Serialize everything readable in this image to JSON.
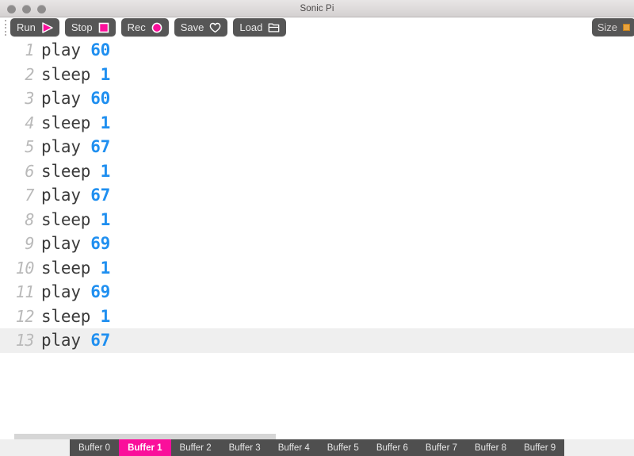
{
  "window": {
    "title": "Sonic Pi",
    "traffic_lights": [
      "close",
      "minimize",
      "maximize"
    ]
  },
  "toolbar": {
    "buttons": [
      {
        "label": "Run",
        "icon": "play-triangle-icon"
      },
      {
        "label": "Stop",
        "icon": "stop-square-icon"
      },
      {
        "label": "Rec",
        "icon": "record-circle-icon"
      },
      {
        "label": "Save",
        "icon": "heart-icon"
      },
      {
        "label": "Load",
        "icon": "folder-icon"
      }
    ],
    "size_button": {
      "label": "Size",
      "icon": "size-swatch-icon"
    },
    "accent_color": "#fa0f9b",
    "button_bg": "#565656"
  },
  "editor": {
    "current_line": 13,
    "number_color": "#1f8ff0",
    "text_color": "#3b3b3b",
    "gutter_color": "#b9b9b9",
    "current_line_bg": "#efefef",
    "lines": [
      {
        "n": "1",
        "kw": "play",
        "arg": "60"
      },
      {
        "n": "2",
        "kw": "sleep",
        "arg": "1"
      },
      {
        "n": "3",
        "kw": "play",
        "arg": "60"
      },
      {
        "n": "4",
        "kw": "sleep",
        "arg": "1"
      },
      {
        "n": "5",
        "kw": "play",
        "arg": "67"
      },
      {
        "n": "6",
        "kw": "sleep",
        "arg": "1"
      },
      {
        "n": "7",
        "kw": "play",
        "arg": "67"
      },
      {
        "n": "8",
        "kw": "sleep",
        "arg": "1"
      },
      {
        "n": "9",
        "kw": "play",
        "arg": "69"
      },
      {
        "n": "10",
        "kw": "sleep",
        "arg": "1"
      },
      {
        "n": "11",
        "kw": "play",
        "arg": "69"
      },
      {
        "n": "12",
        "kw": "sleep",
        "arg": "1"
      },
      {
        "n": "13",
        "kw": "play",
        "arg": "67"
      }
    ]
  },
  "scrollbar": {
    "orientation": "horizontal",
    "thumb_color": "#d6d6d6"
  },
  "buffers": {
    "active_index": 1,
    "tabs": [
      {
        "label": "Buffer 0"
      },
      {
        "label": "Buffer 1"
      },
      {
        "label": "Buffer 2"
      },
      {
        "label": "Buffer 3"
      },
      {
        "label": "Buffer 4"
      },
      {
        "label": "Buffer 5"
      },
      {
        "label": "Buffer 6"
      },
      {
        "label": "Buffer 7"
      },
      {
        "label": "Buffer 8"
      },
      {
        "label": "Buffer 9"
      }
    ]
  }
}
